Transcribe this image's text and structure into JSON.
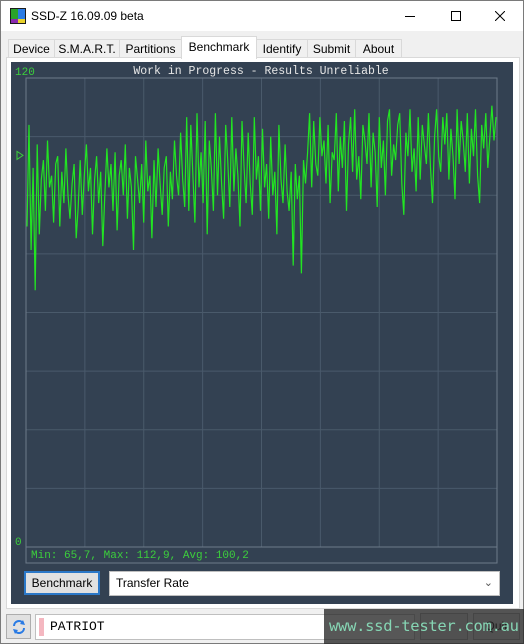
{
  "window": {
    "title": "SSD-Z 16.09.09 beta",
    "icon": "ssdz-app-icon",
    "controls": {
      "minimize": "minimize-icon",
      "maximize": "maximize-icon",
      "close": "close-icon"
    }
  },
  "tabs": [
    {
      "label": "Device",
      "active": false
    },
    {
      "label": "S.M.A.R.T.",
      "active": false
    },
    {
      "label": "Partitions",
      "active": false
    },
    {
      "label": "Benchmark",
      "active": true
    },
    {
      "label": "Identify",
      "active": false
    },
    {
      "label": "Submit",
      "active": false
    },
    {
      "label": "About",
      "active": false
    }
  ],
  "benchmark": {
    "button_label": "Benchmark",
    "mode_selected": "Transfer Rate",
    "mode_icon": "chevron-down-icon"
  },
  "footer": {
    "refresh_icon": "refresh-icon",
    "drive_name": "PATRIOT",
    "button_left_label": "",
    "button_right_label": "Quit"
  },
  "watermark": {
    "text": "www.ssd-tester.com.au"
  },
  "colors": {
    "panel_bg": "#334152",
    "grid": "#4a5a6b",
    "line": "#22e522",
    "label": "#3ccf3c",
    "title_text": "#e6e6e6",
    "accent_button": "#2b78c8"
  },
  "chart_data": {
    "type": "line",
    "title": "Work in Progress - Results Unreliable",
    "ylim": [
      0,
      120
    ],
    "ytick_labels": {
      "top": "120",
      "bottom": "0"
    },
    "avg_marker": 100.2,
    "grid": true,
    "xlabel": "",
    "ylabel": "",
    "stats_text": "Min: 65,7, Max: 112,9, Avg: 100,2",
    "stats": {
      "min": 65.7,
      "max": 112.9,
      "avg": 100.2
    },
    "series": [
      {
        "name": "Transfer Rate",
        "values": [
          82,
          108,
          76,
          97,
          65.7,
          103,
          80,
          94,
          99,
          86,
          104,
          92,
          95,
          83,
          98,
          100,
          82,
          96,
          88,
          102,
          90,
          84,
          93,
          98,
          79,
          87,
          99,
          85,
          95,
          103,
          91,
          97,
          80,
          94,
          100,
          88,
          96,
          77,
          90,
          102,
          92,
          98,
          86,
          101,
          81,
          95,
          99,
          90,
          103,
          84,
          97,
          92,
          76,
          100,
          94,
          88,
          98,
          83,
          104,
          91,
          95,
          79,
          99,
          87,
          102,
          93,
          85,
          97,
          100,
          82,
          96,
          89,
          104,
          95,
          90,
          106,
          94,
          87,
          110,
          86,
          108,
          95,
          83,
          111,
          92,
          101,
          88,
          109,
          80,
          104,
          97,
          86,
          111,
          90,
          105,
          93,
          84,
          108,
          99,
          87,
          110,
          91,
          102,
          95,
          82,
          109,
          97,
          88,
          106,
          93,
          85,
          110,
          94,
          100,
          86,
          107,
          92,
          98,
          84,
          105,
          90,
          96,
          80,
          108,
          94,
          88,
          103,
          91,
          86,
          96,
          72,
          98,
          89,
          95,
          70,
          99,
          93,
          101,
          111,
          92,
          109,
          98,
          95,
          110,
          100,
          104,
          93,
          108,
          88,
          101,
          99,
          111,
          91,
          105,
          97,
          109,
          86,
          103,
          110,
          96,
          112,
          94,
          100,
          89,
          108,
          104,
          98,
          111,
          92,
          106,
          101,
          87,
          110,
          97,
          104,
          90,
          109,
          112,
          95,
          103,
          99,
          108,
          111,
          93,
          85,
          106,
          100,
          112,
          96,
          102,
          91,
          110,
          94,
          108,
          103,
          98,
          111,
          97,
          88,
          105,
          112,
          100,
          96,
          110,
          103,
          111,
          94,
          107,
          100,
          89,
          112,
          98,
          109,
          104,
          96,
          111,
          93,
          107,
          100,
          112,
          95,
          88,
          108,
          102,
          111,
          97,
          105,
          112.9,
          104,
          110
        ]
      }
    ]
  }
}
